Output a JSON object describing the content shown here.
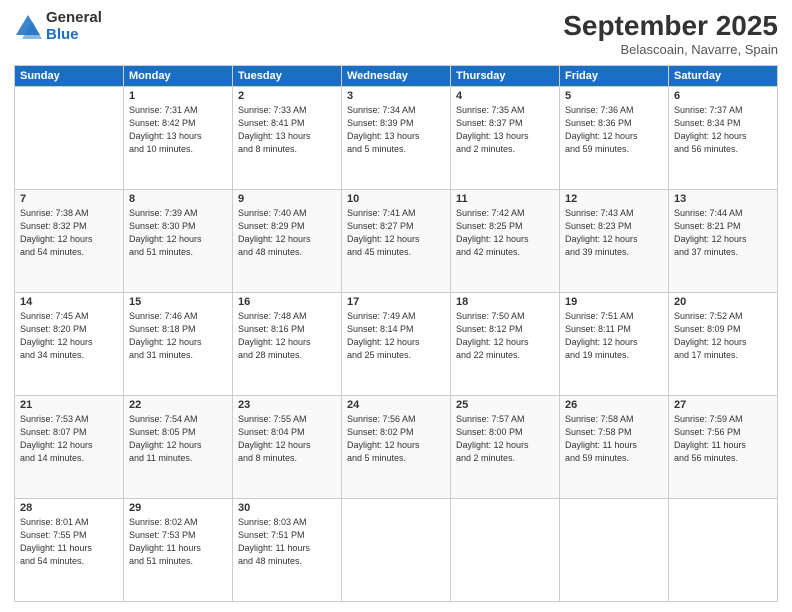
{
  "logo": {
    "general": "General",
    "blue": "Blue"
  },
  "header": {
    "month": "September 2025",
    "location": "Belascoain, Navarre, Spain"
  },
  "days_of_week": [
    "Sunday",
    "Monday",
    "Tuesday",
    "Wednesday",
    "Thursday",
    "Friday",
    "Saturday"
  ],
  "weeks": [
    [
      {
        "num": "",
        "info": ""
      },
      {
        "num": "1",
        "info": "Sunrise: 7:31 AM\nSunset: 8:42 PM\nDaylight: 13 hours\nand 10 minutes."
      },
      {
        "num": "2",
        "info": "Sunrise: 7:33 AM\nSunset: 8:41 PM\nDaylight: 13 hours\nand 8 minutes."
      },
      {
        "num": "3",
        "info": "Sunrise: 7:34 AM\nSunset: 8:39 PM\nDaylight: 13 hours\nand 5 minutes."
      },
      {
        "num": "4",
        "info": "Sunrise: 7:35 AM\nSunset: 8:37 PM\nDaylight: 13 hours\nand 2 minutes."
      },
      {
        "num": "5",
        "info": "Sunrise: 7:36 AM\nSunset: 8:36 PM\nDaylight: 12 hours\nand 59 minutes."
      },
      {
        "num": "6",
        "info": "Sunrise: 7:37 AM\nSunset: 8:34 PM\nDaylight: 12 hours\nand 56 minutes."
      }
    ],
    [
      {
        "num": "7",
        "info": "Sunrise: 7:38 AM\nSunset: 8:32 PM\nDaylight: 12 hours\nand 54 minutes."
      },
      {
        "num": "8",
        "info": "Sunrise: 7:39 AM\nSunset: 8:30 PM\nDaylight: 12 hours\nand 51 minutes."
      },
      {
        "num": "9",
        "info": "Sunrise: 7:40 AM\nSunset: 8:29 PM\nDaylight: 12 hours\nand 48 minutes."
      },
      {
        "num": "10",
        "info": "Sunrise: 7:41 AM\nSunset: 8:27 PM\nDaylight: 12 hours\nand 45 minutes."
      },
      {
        "num": "11",
        "info": "Sunrise: 7:42 AM\nSunset: 8:25 PM\nDaylight: 12 hours\nand 42 minutes."
      },
      {
        "num": "12",
        "info": "Sunrise: 7:43 AM\nSunset: 8:23 PM\nDaylight: 12 hours\nand 39 minutes."
      },
      {
        "num": "13",
        "info": "Sunrise: 7:44 AM\nSunset: 8:21 PM\nDaylight: 12 hours\nand 37 minutes."
      }
    ],
    [
      {
        "num": "14",
        "info": "Sunrise: 7:45 AM\nSunset: 8:20 PM\nDaylight: 12 hours\nand 34 minutes."
      },
      {
        "num": "15",
        "info": "Sunrise: 7:46 AM\nSunset: 8:18 PM\nDaylight: 12 hours\nand 31 minutes."
      },
      {
        "num": "16",
        "info": "Sunrise: 7:48 AM\nSunset: 8:16 PM\nDaylight: 12 hours\nand 28 minutes."
      },
      {
        "num": "17",
        "info": "Sunrise: 7:49 AM\nSunset: 8:14 PM\nDaylight: 12 hours\nand 25 minutes."
      },
      {
        "num": "18",
        "info": "Sunrise: 7:50 AM\nSunset: 8:12 PM\nDaylight: 12 hours\nand 22 minutes."
      },
      {
        "num": "19",
        "info": "Sunrise: 7:51 AM\nSunset: 8:11 PM\nDaylight: 12 hours\nand 19 minutes."
      },
      {
        "num": "20",
        "info": "Sunrise: 7:52 AM\nSunset: 8:09 PM\nDaylight: 12 hours\nand 17 minutes."
      }
    ],
    [
      {
        "num": "21",
        "info": "Sunrise: 7:53 AM\nSunset: 8:07 PM\nDaylight: 12 hours\nand 14 minutes."
      },
      {
        "num": "22",
        "info": "Sunrise: 7:54 AM\nSunset: 8:05 PM\nDaylight: 12 hours\nand 11 minutes."
      },
      {
        "num": "23",
        "info": "Sunrise: 7:55 AM\nSunset: 8:04 PM\nDaylight: 12 hours\nand 8 minutes."
      },
      {
        "num": "24",
        "info": "Sunrise: 7:56 AM\nSunset: 8:02 PM\nDaylight: 12 hours\nand 5 minutes."
      },
      {
        "num": "25",
        "info": "Sunrise: 7:57 AM\nSunset: 8:00 PM\nDaylight: 12 hours\nand 2 minutes."
      },
      {
        "num": "26",
        "info": "Sunrise: 7:58 AM\nSunset: 7:58 PM\nDaylight: 11 hours\nand 59 minutes."
      },
      {
        "num": "27",
        "info": "Sunrise: 7:59 AM\nSunset: 7:56 PM\nDaylight: 11 hours\nand 56 minutes."
      }
    ],
    [
      {
        "num": "28",
        "info": "Sunrise: 8:01 AM\nSunset: 7:55 PM\nDaylight: 11 hours\nand 54 minutes."
      },
      {
        "num": "29",
        "info": "Sunrise: 8:02 AM\nSunset: 7:53 PM\nDaylight: 11 hours\nand 51 minutes."
      },
      {
        "num": "30",
        "info": "Sunrise: 8:03 AM\nSunset: 7:51 PM\nDaylight: 11 hours\nand 48 minutes."
      },
      {
        "num": "",
        "info": ""
      },
      {
        "num": "",
        "info": ""
      },
      {
        "num": "",
        "info": ""
      },
      {
        "num": "",
        "info": ""
      }
    ]
  ]
}
